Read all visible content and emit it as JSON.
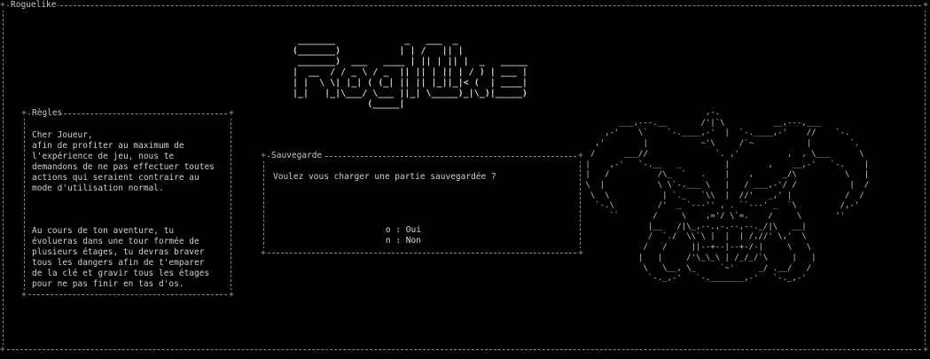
{
  "window": {
    "title": "Roguelike"
  },
  "logo": {
    "art": " _______             _   ___  _\n(_______)           | | /   || |\n _______)  ___   ____ | || | || |  _   _____\n|  __  / / _ \\ / _  || || | || | / ) | ___ |\n| |  \\ \\| |_| ( (_| || || |_||_|< (  | ____|\n|_|   |_|\\___/ \\___ ||_| \\_____)_|\\_)|_____)\n              (_____|"
  },
  "rules": {
    "title": "Règles",
    "paragraph1": "Cher Joueur,\nafin de profiter au maximum de\nl'expérience de jeu, nous te\ndemandons de ne pas effectuer toutes\nactions qui seraient contraire au\nmode d'utilisation normal.",
    "paragraph2": "Au cours de ton aventure, tu\névolueras dans une tour formée de\nplusieurs étages, tu devras braver\ntous les dangers afin de t'emparer\nde la clé et gravir tous les étages\npour ne pas finir en tas d'os."
  },
  "save_dialog": {
    "title": "Sauvegarde",
    "question": "Voulez vous charger une partie sauvegardée ?",
    "yes_label": "o : Oui",
    "no_label": "n : Non"
  },
  "skull": {
    "art": "                          ,-.\n        ___,---.__       /'|`\\          __,---,___\n     ,-'    \\`    `-.____,-'  |  `-.____,-'    //    `-.\n   ,'        |           ~'\\     /`~           |        `.\n  /      ___//              `. ,'          ,  , \\___      \\\n |    ,-'   `-.__   _         |        ,    __,-'   `-.    |\n |   /          /\\_  `   .    |    ,      _/\\          \\   |\n \\  |           \\ \\`-.___ \\   |   / ___,-'/ /           |  /\n  \\  \\           | `._   `\\\\  |  //'   _,' |           /  /\n   `-.\\         /'  _ `---'' , . ``---' _  `\\         /,-'\n      ``       /     \\    ,='/ \\`=.    /     \\       ''\n              |__   /|\\_,--.,-.--,--._/|\\   __|\n              /  `./  \\\\`\\ |  |  | /,//' \\,'  \\\n             /   /     ||--+--|--+-/-|     \\   \\\n            |   |     /'\\_\\_\\ | /_/_/`\\     |   |\n             \\   \\__, \\_     `~'     _/ .__/   /\n              `-._,-'   `-._______,-'   `-._,-'"
  }
}
